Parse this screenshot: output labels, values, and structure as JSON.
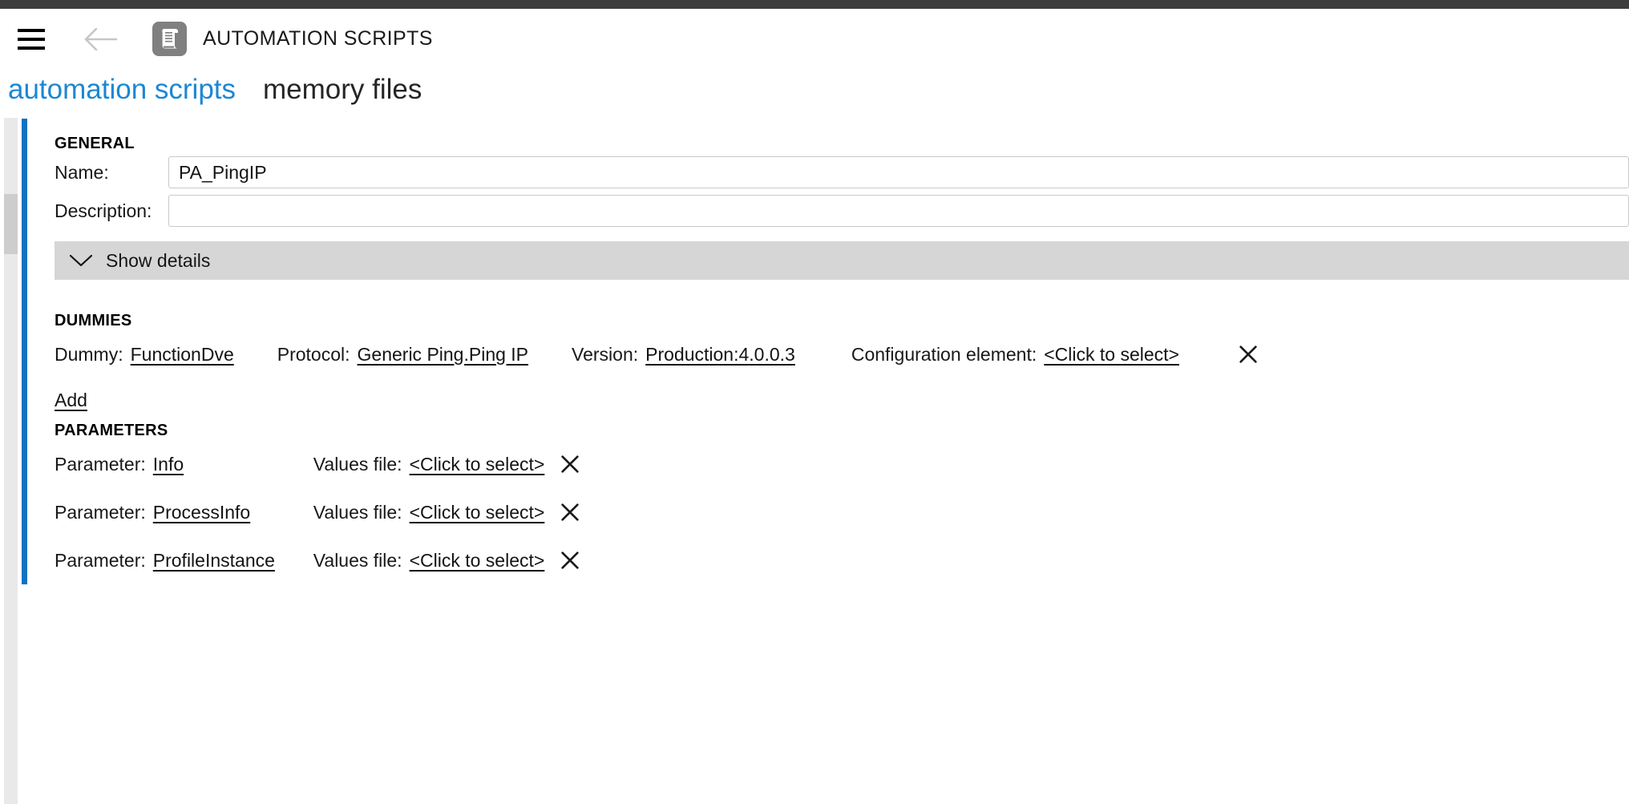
{
  "window": {
    "titlebar_color": "#3d3d3d"
  },
  "header": {
    "menu_icon": "hamburger-icon",
    "back_icon": "back-arrow-icon",
    "app_icon": "scroll-icon",
    "title": "AUTOMATION SCRIPTS"
  },
  "tabs": [
    {
      "label": "automation scripts",
      "active": true
    },
    {
      "label": "memory files",
      "active": false
    }
  ],
  "colors": {
    "accent_blue": "#0f73c0",
    "tab_active": "#1b87d4",
    "bar_gray": "#d6d6d6",
    "scroll_track": "#e9e9e9",
    "scroll_thumb": "#cdcdcd",
    "icon_gray": "#808080"
  },
  "sections": {
    "general": {
      "title": "GENERAL",
      "fields": [
        {
          "label": "Name:",
          "value": "PA_PingIP",
          "placeholder": ""
        },
        {
          "label": "Description:",
          "value": "",
          "placeholder": ""
        }
      ],
      "show_details": {
        "label": "Show details",
        "icon": "chevron-down-icon"
      }
    },
    "dummies": {
      "title": "DUMMIES",
      "rows": [
        {
          "dummy_label": "Dummy:",
          "dummy_value": "FunctionDve",
          "protocol_label": "Protocol:",
          "protocol_value": "Generic Ping.Ping IP",
          "version_label": "Version:",
          "version_value": "Production:4.0.0.3",
          "config_label": "Configuration element:",
          "config_value": "<Click to select>",
          "delete_icon": "close-icon"
        }
      ],
      "add_label": "Add"
    },
    "parameters": {
      "title": "PARAMETERS",
      "rows": [
        {
          "param_label": "Parameter:",
          "param_value": "Info",
          "values_file_label": "Values file:",
          "values_file_value": "<Click to select>",
          "delete_icon": "close-icon"
        },
        {
          "param_label": "Parameter:",
          "param_value": "ProcessInfo",
          "values_file_label": "Values file:",
          "values_file_value": "<Click to select>",
          "delete_icon": "close-icon"
        },
        {
          "param_label": "Parameter:",
          "param_value": "ProfileInstance",
          "values_file_label": "Values file:",
          "values_file_value": "<Click to select>",
          "delete_icon": "close-icon"
        }
      ]
    }
  }
}
